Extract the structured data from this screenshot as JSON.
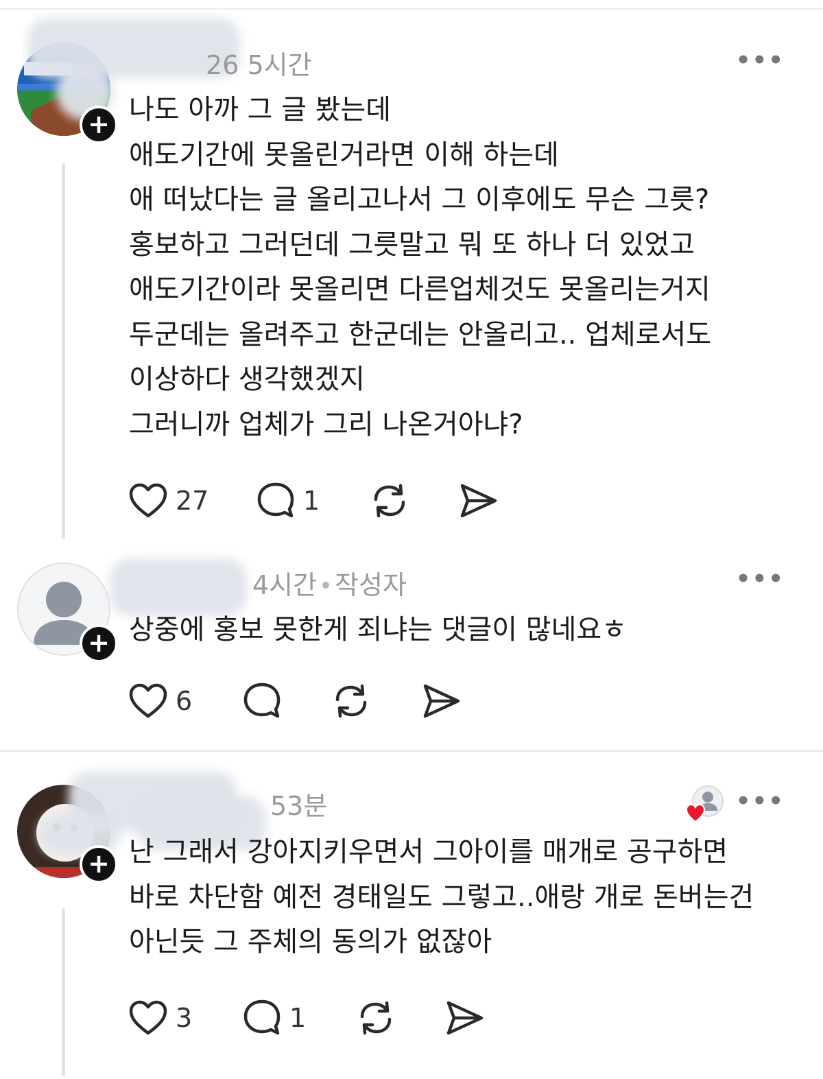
{
  "colors": {
    "text": "#1a1a1a",
    "meta": "#9a9a9a",
    "heart_badge": "#e8192c",
    "divider": "#e6e6e6"
  },
  "comments": [
    {
      "username": "",
      "username_tail": "26",
      "time": "5시간",
      "author_tag": "",
      "text": "나도 아까 그 글 봤는데\n애도기간에 못올린거라면 이해 하는데\n애 떠났다는 글 올리고나서 그 이후에도 무슨 그릇?\n홍보하고 그러던데 그릇말고 뭐 또 하나 더 있었고\n애도기간이라 못올리면 다른업체것도 못올리는거지\n두군데는 올려주고 한군데는 안올리고.. 업체로서도\n이상하다 생각했겠지\n그러니까 업체가 그리 나온거아냐?",
      "likes": "27",
      "replies": "1",
      "more_icon": "ellipsis-icon",
      "follow_symbol": "+"
    },
    {
      "username": "",
      "time": "4시간",
      "author_tag": "작성자",
      "text": "상중에 홍보 못한게 죄냐는 댓글이 많네요ㅎ",
      "likes": "6",
      "replies": "",
      "more_icon": "ellipsis-icon",
      "follow_symbol": "+"
    },
    {
      "username": "",
      "time": "53분",
      "author_tag": "",
      "text": "난 그래서 강아지키우면서 그아이를 매개로 공구하면\n바로 차단함 예전 경태일도 그렇고..애랑 개로 돈버는건\n아닌듯 그 주체의 동의가 없잖아",
      "likes": "3",
      "replies": "1",
      "more_icon": "ellipsis-icon",
      "follow_symbol": "+"
    }
  ]
}
